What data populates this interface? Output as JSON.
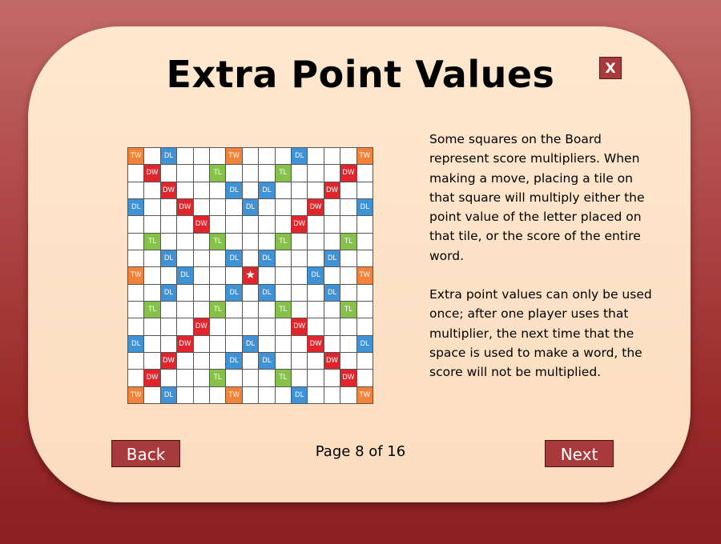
{
  "title": "Extra Point Values",
  "close_label": "X",
  "board": {
    "rows": [
      [
        "TW",
        "",
        "DL",
        "",
        "",
        "",
        "TW",
        "",
        "",
        "",
        "DL",
        "",
        "",
        "",
        "TW"
      ],
      [
        "",
        "DW",
        "",
        "",
        "",
        "TL",
        "",
        "",
        "",
        "TL",
        "",
        "",
        "",
        "DW",
        ""
      ],
      [
        "",
        "",
        "DW",
        "",
        "",
        "",
        "DL",
        "",
        "DL",
        "",
        "",
        "",
        "DW",
        "",
        ""
      ],
      [
        "DL",
        "",
        "",
        "DW",
        "",
        "",
        "",
        "DL",
        "",
        "",
        "",
        "DW",
        "",
        "",
        "DL"
      ],
      [
        "",
        "",
        "",
        "",
        "DW",
        "",
        "",
        "",
        "",
        "",
        "DW",
        "",
        "",
        "",
        ""
      ],
      [
        "",
        "TL",
        "",
        "",
        "",
        "TL",
        "",
        "",
        "",
        "TL",
        "",
        "",
        "",
        "TL",
        ""
      ],
      [
        "",
        "",
        "DL",
        "",
        "",
        "",
        "DL",
        "",
        "DL",
        "",
        "",
        "",
        "DL",
        "",
        ""
      ],
      [
        "TW",
        "",
        "",
        "DL",
        "",
        "",
        "",
        "STAR",
        "",
        "",
        "",
        "DL",
        "",
        "",
        "TW"
      ],
      [
        "",
        "",
        "DL",
        "",
        "",
        "",
        "DL",
        "",
        "DL",
        "",
        "",
        "",
        "DL",
        "",
        ""
      ],
      [
        "",
        "TL",
        "",
        "",
        "",
        "TL",
        "",
        "",
        "",
        "TL",
        "",
        "",
        "",
        "TL",
        ""
      ],
      [
        "",
        "",
        "",
        "",
        "DW",
        "",
        "",
        "",
        "",
        "",
        "DW",
        "",
        "",
        "",
        ""
      ],
      [
        "DL",
        "",
        "",
        "DW",
        "",
        "",
        "",
        "DL",
        "",
        "",
        "",
        "DW",
        "",
        "",
        "DL"
      ],
      [
        "",
        "",
        "DW",
        "",
        "",
        "",
        "DL",
        "",
        "DL",
        "",
        "",
        "",
        "DW",
        "",
        ""
      ],
      [
        "",
        "DW",
        "",
        "",
        "",
        "TL",
        "",
        "",
        "",
        "TL",
        "",
        "",
        "",
        "DW",
        ""
      ],
      [
        "TW",
        "",
        "DL",
        "",
        "",
        "",
        "TW",
        "",
        "",
        "",
        "DL",
        "",
        "",
        "",
        "TW"
      ]
    ],
    "labels": {
      "TW": "TW",
      "DW": "DW",
      "TL": "TL",
      "DL": "DL",
      "STAR": "★"
    },
    "colors": {
      "TW": "#f0823a",
      "DW": "#e0262c",
      "TL": "#86c24a",
      "DL": "#3f92d6"
    }
  },
  "description": {
    "paragraph1": "Some squares on the Board represent score multipliers. When making a move, placing a tile on that square will multiply either the point value of the letter placed on that tile, or the score of the entire word.",
    "paragraph2": "Extra point values can only be used once; after one player uses that multiplier, the next time that the space is used to make a word, the score will not be multiplied."
  },
  "navigation": {
    "back_label": "Back",
    "next_label": "Next",
    "page_indicator": "Page 8 of 16"
  },
  "colors": {
    "accent_button": "#a83a3c",
    "panel": "#fde0c4",
    "background_top": "#c26a68",
    "background_bottom": "#8c1f22"
  }
}
